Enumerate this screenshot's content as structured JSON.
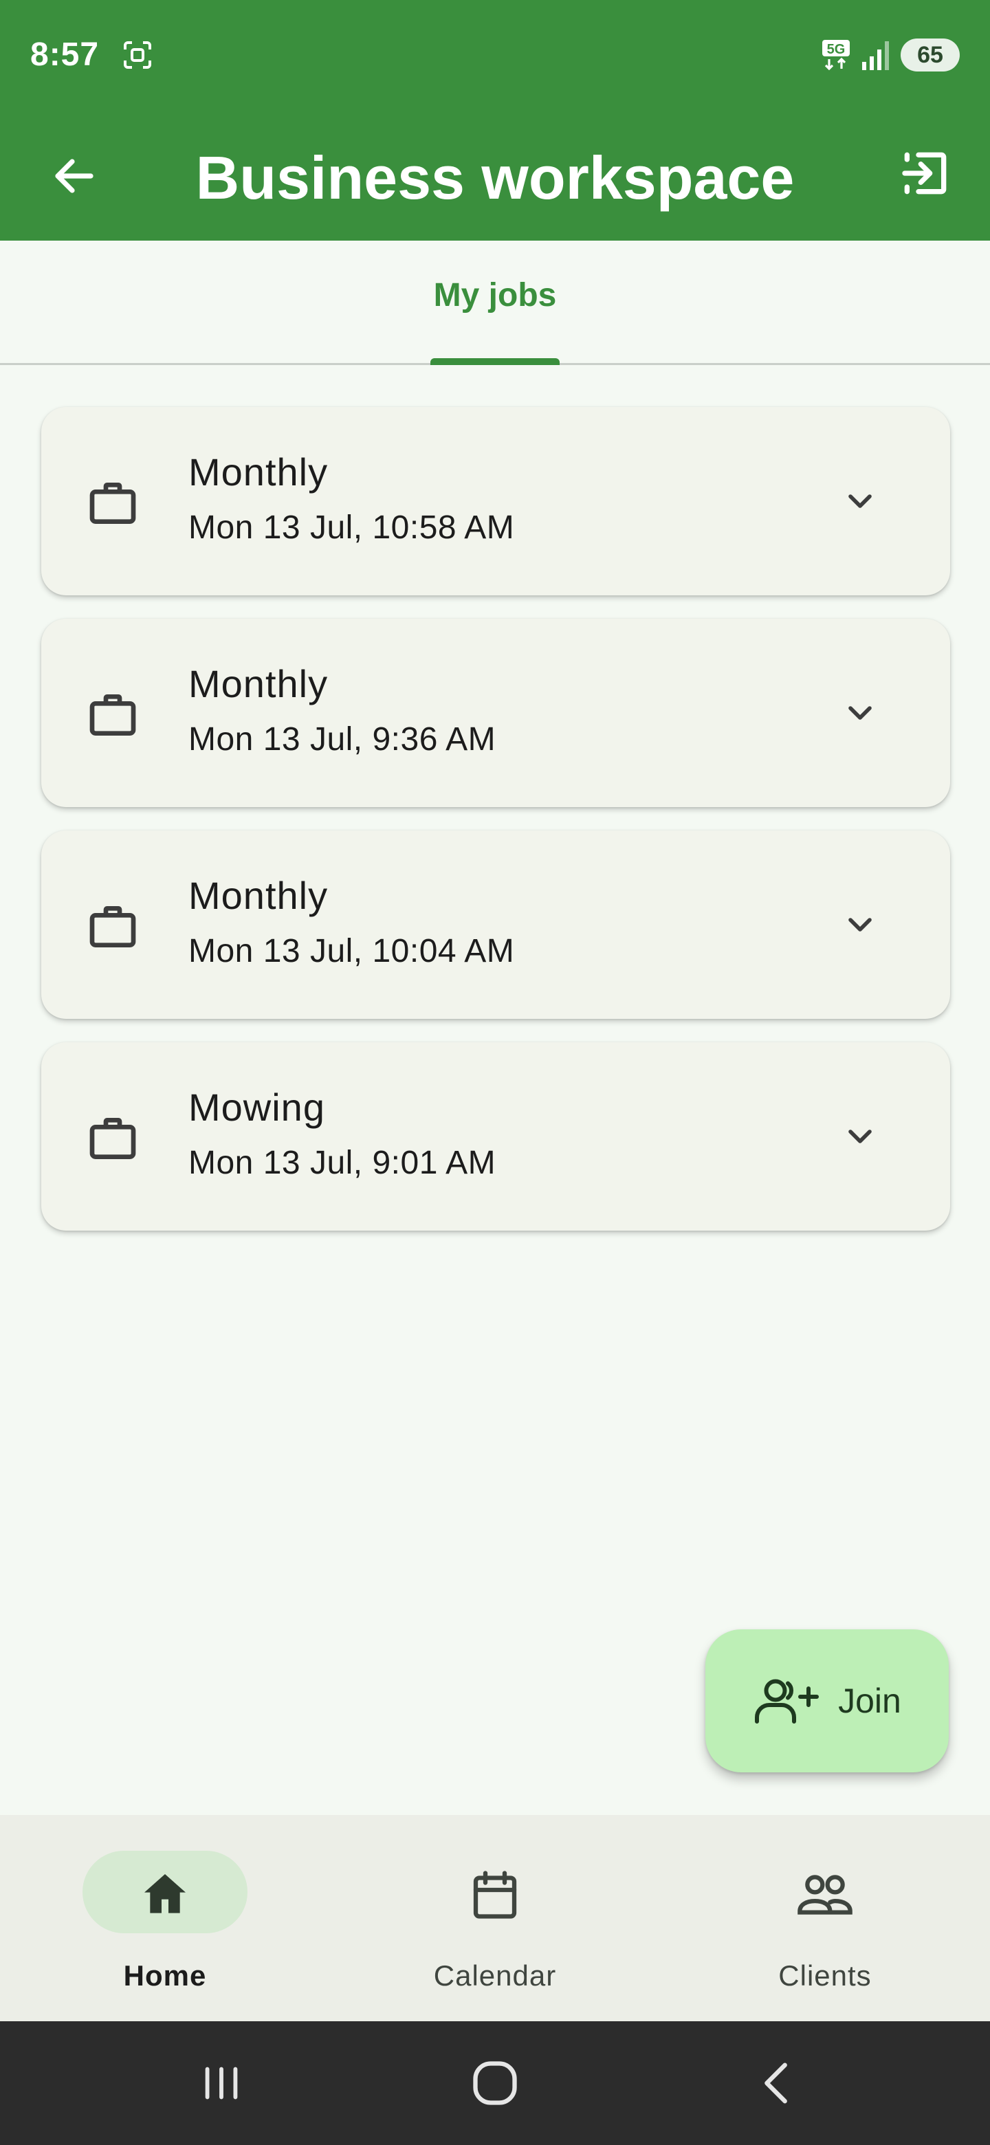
{
  "status_bar": {
    "time": "8:57",
    "network": "5G",
    "battery": "65",
    "icons": [
      "screenshot-icon",
      "5g-icon",
      "signal-icon",
      "battery-icon"
    ]
  },
  "app_bar": {
    "title": "Business workspace",
    "back_icon": "arrow-back-icon",
    "exit_icon": "exit-to-app-icon",
    "background": "#3A8F3D"
  },
  "tabs": [
    {
      "label": "My jobs",
      "active": true
    }
  ],
  "jobs": [
    {
      "title": "Monthly",
      "date": "Mon 13 Jul, 10:58 AM",
      "icon": "briefcase-icon"
    },
    {
      "title": "Monthly",
      "date": "Mon 13 Jul, 9:36 AM",
      "icon": "briefcase-icon"
    },
    {
      "title": "Monthly",
      "date": "Mon 13 Jul, 10:04 AM",
      "icon": "briefcase-icon"
    },
    {
      "title": "Mowing",
      "date": "Mon 13 Jul, 9:01 AM",
      "icon": "briefcase-icon"
    }
  ],
  "fab": {
    "label": "Join",
    "icon": "person-add-icon",
    "color": "#BDEFB6"
  },
  "bottom_nav": [
    {
      "label": "Home",
      "icon": "home-icon",
      "active": true
    },
    {
      "label": "Calendar",
      "icon": "calendar-icon",
      "active": false
    },
    {
      "label": "Clients",
      "icon": "people-icon",
      "active": false
    }
  ],
  "system_nav": [
    "recents-icon",
    "home-circle-icon",
    "back-chevron-icon"
  ],
  "colors": {
    "accent": "#3A8F3D",
    "card": "#F2F4EC",
    "page": "#F4F9F3"
  }
}
